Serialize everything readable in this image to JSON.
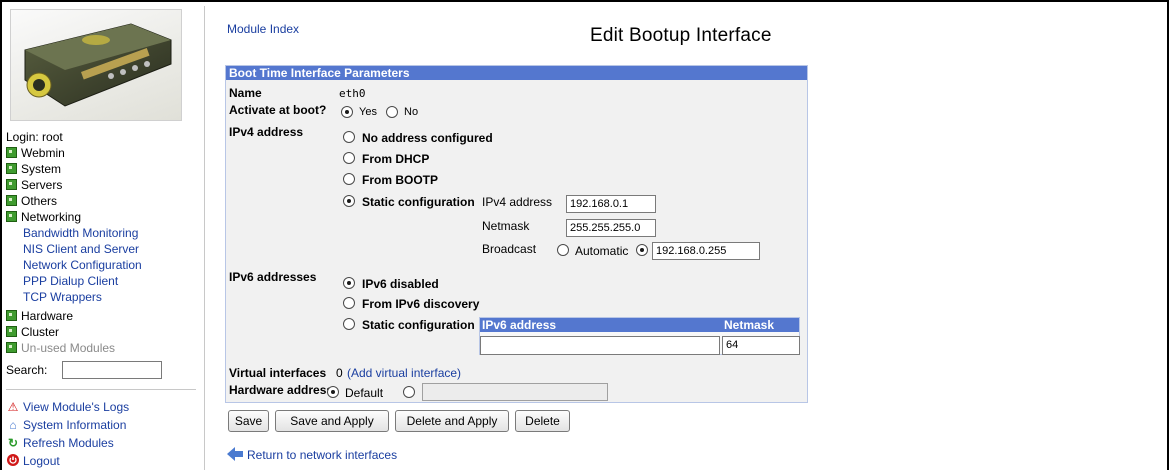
{
  "sidebar": {
    "login": "Login: root",
    "categories": [
      {
        "label": "Webmin"
      },
      {
        "label": "System"
      },
      {
        "label": "Servers"
      },
      {
        "label": "Others"
      },
      {
        "label": "Networking"
      }
    ],
    "networking_items": [
      "Bandwidth Monitoring",
      "NIS Client and Server",
      "Network Configuration",
      "PPP Dialup Client",
      "TCP Wrappers"
    ],
    "more_categories": [
      {
        "label": "Hardware"
      },
      {
        "label": "Cluster"
      },
      {
        "label": "Un-used Modules"
      }
    ],
    "search_label": "Search:",
    "search_value": "",
    "links": {
      "view_logs": "View Module's Logs",
      "system_info": "System Information",
      "refresh": "Refresh Modules",
      "logout": "Logout"
    }
  },
  "header": {
    "module_index": "Module Index",
    "title": "Edit Bootup Interface"
  },
  "form": {
    "section_title": "Boot Time Interface Parameters",
    "name_label": "Name",
    "name_value": "eth0",
    "activate_label": "Activate at boot?",
    "activate_yes": "Yes",
    "activate_no": "No",
    "activate_selected": "Yes",
    "ipv4_label": "IPv4 address",
    "ipv4_opt_none": "No address configured",
    "ipv4_opt_dhcp": "From DHCP",
    "ipv4_opt_bootp": "From BOOTP",
    "ipv4_opt_static": "Static configuration",
    "ipv4_selected": "Static configuration",
    "ipv4_addr_label": "IPv4 address",
    "ipv4_addr_value": "192.168.0.1",
    "netmask_label": "Netmask",
    "netmask_value": "255.255.255.0",
    "broadcast_label": "Broadcast",
    "broadcast_auto": "Automatic",
    "broadcast_value": "192.168.0.255",
    "ipv6_label": "IPv6 addresses",
    "ipv6_opt_disabled": "IPv6 disabled",
    "ipv6_opt_discovery": "From IPv6 discovery",
    "ipv6_opt_static": "Static configuration",
    "ipv6_selected": "IPv6 disabled",
    "ipv6_col_address": "IPv6 address",
    "ipv6_col_netmask": "Netmask",
    "ipv6_address_value": "",
    "ipv6_netmask_value": "64",
    "virtual_label": "Virtual interfaces",
    "virtual_count": "0",
    "virtual_add_link": "(Add virtual interface)",
    "hw_label": "Hardware address",
    "hw_default": "Default",
    "hw_value": ""
  },
  "buttons": {
    "save": "Save",
    "save_apply": "Save and Apply",
    "delete_apply": "Delete and Apply",
    "delete": "Delete"
  },
  "footer": {
    "return_link": "Return to network interfaces"
  },
  "colors": {
    "header_bar": "#5477cf",
    "link": "#1a3ea0",
    "category_icon": "#3f9b2f"
  }
}
